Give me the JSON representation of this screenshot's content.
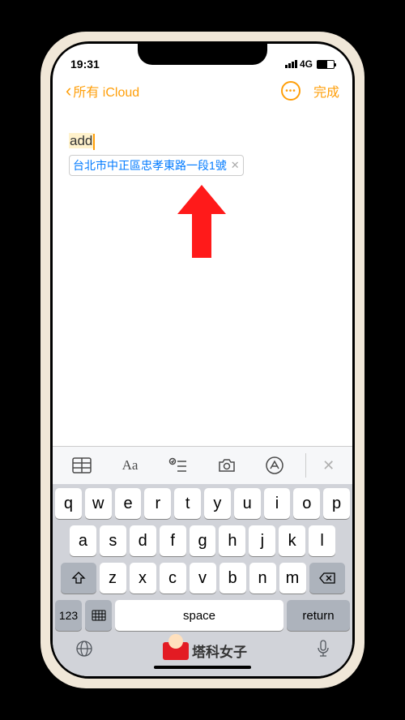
{
  "status": {
    "time": "19:31",
    "network": "4G"
  },
  "nav": {
    "back_label": "所有 iCloud",
    "done_label": "完成"
  },
  "note": {
    "typed": "add",
    "suggestion": "台北市中正區忠孝東路一段1號"
  },
  "toolbar": {
    "icons": [
      "table",
      "text-format",
      "checklist",
      "camera",
      "markup",
      "close"
    ]
  },
  "keyboard": {
    "row1": [
      "q",
      "w",
      "e",
      "r",
      "t",
      "y",
      "u",
      "i",
      "o",
      "p"
    ],
    "row2": [
      "a",
      "s",
      "d",
      "f",
      "g",
      "h",
      "j",
      "k",
      "l"
    ],
    "row3": [
      "z",
      "x",
      "c",
      "v",
      "b",
      "n",
      "m"
    ],
    "num_key": "123",
    "space_label": "space",
    "return_label": "return"
  },
  "brand": {
    "text": "塔科女子"
  }
}
